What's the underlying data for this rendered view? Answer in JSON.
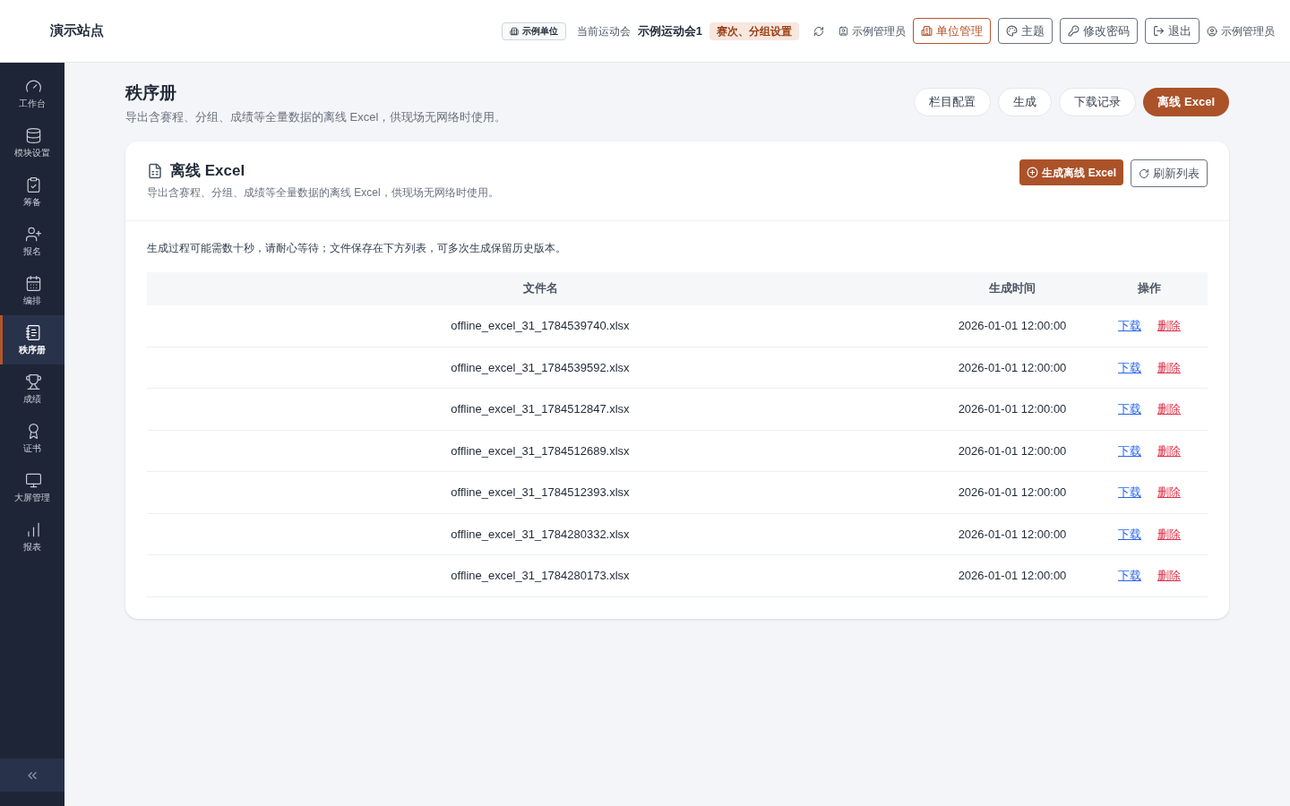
{
  "site_title": "演示站点",
  "header": {
    "unit_badge": "示例单位",
    "meet_label": "当前运动会",
    "meet_name": "示例运动会1",
    "settings_tag": "赛次、分组设置",
    "admin_label": "示例管理员",
    "buttons": [
      {
        "label": "单位管理",
        "kind": "primary"
      },
      {
        "label": "主题",
        "kind": "theme"
      },
      {
        "label": "修改密码",
        "kind": "password"
      },
      {
        "label": "退出",
        "kind": "logout"
      }
    ],
    "user": "示例管理员"
  },
  "sidebar": {
    "items": [
      {
        "label": "工作台",
        "kind": "gauge",
        "selected": false
      },
      {
        "label": "模块设置",
        "kind": "database",
        "selected": false
      },
      {
        "label": "筹备",
        "kind": "clipboard",
        "selected": false
      },
      {
        "label": "报名",
        "kind": "user",
        "selected": false
      },
      {
        "label": "编排",
        "kind": "calendar",
        "selected": false
      },
      {
        "label": "秩序册",
        "kind": "notebook",
        "selected": true
      },
      {
        "label": "成绩",
        "kind": "trophy",
        "selected": false
      },
      {
        "label": "证书",
        "kind": "award",
        "selected": false
      },
      {
        "label": "大屏管理",
        "kind": "monitor",
        "selected": false
      },
      {
        "label": "报表",
        "kind": "chart",
        "selected": false
      }
    ]
  },
  "page": {
    "title": "秩序册",
    "subtitle": "导出含赛程、分组、成绩等全量数据的离线 Excel，供现场无网络时使用。",
    "tabs": [
      {
        "label": "栏目配置",
        "selected": false
      },
      {
        "label": "生成",
        "selected": false
      },
      {
        "label": "下载记录",
        "selected": false
      },
      {
        "label": "离线 Excel",
        "selected": true
      }
    ]
  },
  "card": {
    "title": "离线 Excel",
    "subtitle": "导出含赛程、分组、成绩等全量数据的离线 Excel，供现场无网络时使用。",
    "generate_button": "生成离线 Excel",
    "refresh_button": "刷新列表",
    "note": "生成过程可能需数十秒，请耐心等待；文件保存在下方列表，可多次生成保留历史版本。",
    "table": {
      "columns": [
        "文件名",
        "生成时间",
        "操作"
      ],
      "rows": [
        {
          "file": "offline_excel_31_1784539740.xlsx",
          "time": "2026-01-01 12:00:00",
          "download": "下载",
          "delete": "删除"
        },
        {
          "file": "offline_excel_31_1784539592.xlsx",
          "time": "2026-01-01 12:00:00",
          "download": "下载",
          "delete": "删除"
        },
        {
          "file": "offline_excel_31_1784512847.xlsx",
          "time": "2026-01-01 12:00:00",
          "download": "下载",
          "delete": "删除"
        },
        {
          "file": "offline_excel_31_1784512689.xlsx",
          "time": "2026-01-01 12:00:00",
          "download": "下载",
          "delete": "删除"
        },
        {
          "file": "offline_excel_31_1784512393.xlsx",
          "time": "2026-01-01 12:00:00",
          "download": "下载",
          "delete": "删除"
        },
        {
          "file": "offline_excel_31_1784280332.xlsx",
          "time": "2026-01-01 12:00:00",
          "download": "下载",
          "delete": "删除"
        },
        {
          "file": "offline_excel_31_1784280173.xlsx",
          "time": "2026-01-01 12:00:00",
          "download": "下载",
          "delete": "删除"
        }
      ]
    }
  }
}
